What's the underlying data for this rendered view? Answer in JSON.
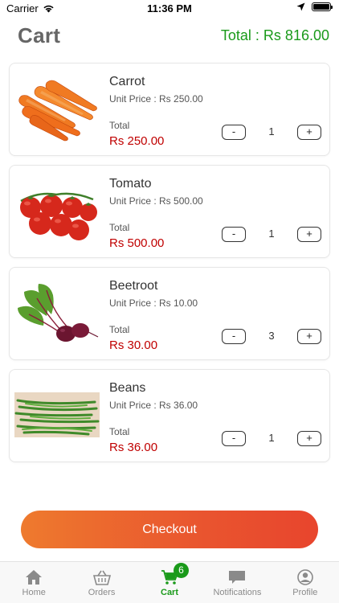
{
  "status_bar": {
    "carrier": "Carrier",
    "time": "11:36 PM"
  },
  "header": {
    "title": "Cart",
    "total": "Total : Rs 816.00"
  },
  "cart": {
    "items": [
      {
        "name": "Carrot",
        "unit_price": "Unit Price : Rs 250.00",
        "total_label": "Total",
        "total": "Rs 250.00",
        "quantity": "1",
        "minus_label": "-",
        "plus_label": "+"
      },
      {
        "name": "Tomato",
        "unit_price": "Unit Price : Rs 500.00",
        "total_label": "Total",
        "total": "Rs 500.00",
        "quantity": "1",
        "minus_label": "-",
        "plus_label": "+"
      },
      {
        "name": "Beetroot",
        "unit_price": "Unit Price : Rs 10.00",
        "total_label": "Total",
        "total": "Rs 30.00",
        "quantity": "3",
        "minus_label": "-",
        "plus_label": "+"
      },
      {
        "name": "Beans",
        "unit_price": "Unit Price : Rs 36.00",
        "total_label": "Total",
        "total": "Rs 36.00",
        "quantity": "1",
        "minus_label": "-",
        "plus_label": "+"
      }
    ]
  },
  "checkout": {
    "label": "Checkout"
  },
  "tab_bar": {
    "tabs": [
      {
        "label": "Home",
        "icon": "home-icon"
      },
      {
        "label": "Orders",
        "icon": "basket-icon"
      },
      {
        "label": "Cart",
        "icon": "cart-icon",
        "badge": "6",
        "active": true
      },
      {
        "label": "Notifications",
        "icon": "chat-bubble-icon"
      },
      {
        "label": "Profile",
        "icon": "user-circle-icon"
      }
    ]
  },
  "colors": {
    "accent_green": "#1a9a1a",
    "price_red": "#c00000",
    "checkout_gradient_start": "#ee7a2e",
    "checkout_gradient_end": "#e8452d"
  }
}
